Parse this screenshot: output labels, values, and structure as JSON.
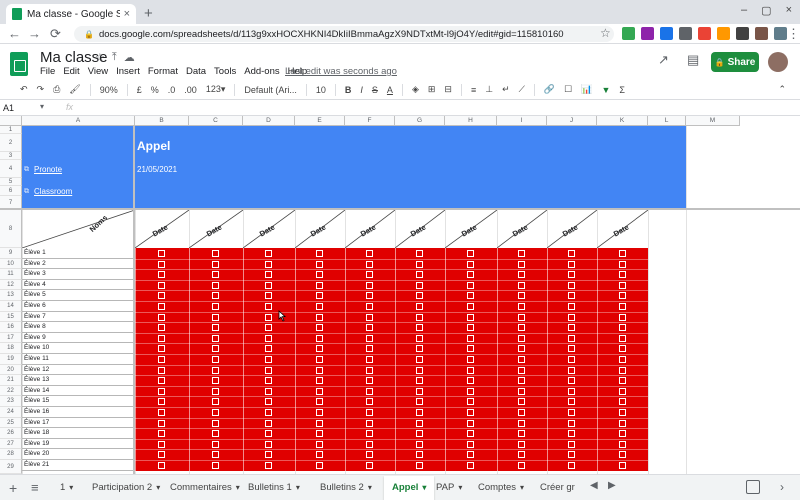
{
  "browser": {
    "tab_title": "Ma classe - Google Sheets",
    "tab_close": "×",
    "new_tab": "+",
    "window_controls": [
      "–",
      "▢",
      "×"
    ],
    "nav": {
      "back": "←",
      "forward": "→",
      "reload": "⟳"
    },
    "lock": "🔒",
    "url": "docs.google.com/spreadsheets/d/113g9xxHOCXHKNI4DkIiIBmmaAgzX9NDTxtMt-l9jO4Y/edit#gid=115810160",
    "star": "☆",
    "menu_dots": "⋮",
    "extension_colors": [
      "#34a853",
      "#8e24aa",
      "#1a73e8",
      "#5f6368",
      "#ea4335",
      "#ff9800",
      "#424242",
      "#795548",
      "#607d8b"
    ]
  },
  "sheets": {
    "doc_title": "Ma classe",
    "title_icons": [
      "☆",
      "⤒",
      "☁"
    ],
    "menu": [
      "File",
      "Edit",
      "View",
      "Insert",
      "Format",
      "Data",
      "Tools",
      "Add-ons",
      "Help"
    ],
    "last_edit": "Last edit was seconds ago",
    "share_label": "Share",
    "share_icon": "🔒",
    "icons_right": [
      "↗",
      "▤"
    ]
  },
  "toolbar": {
    "undo": "↶",
    "redo": "↷",
    "print": "⎙",
    "paint": "🖌",
    "zoom": "90%",
    "currency": "£",
    "percent": "%",
    "dec_down": ".0",
    "dec_up": ".00",
    "format_more": "123▾",
    "font": "Default (Ari...",
    "font_size": "10",
    "bold": "B",
    "italic": "I",
    "strike": "S",
    "text_color": "A",
    "fill": "◈",
    "borders": "⊞",
    "merge": "⊟",
    "halign": "≡",
    "valign": "⊥",
    "wrap": "↵",
    "rotate": "⟋",
    "link": "🔗",
    "comment": "☐",
    "chart": "📊",
    "filter": "▼",
    "functions": "Σ",
    "more": "⌃"
  },
  "formula_bar": {
    "cell_ref": "A1",
    "fx": "fx"
  },
  "grid": {
    "col_headers": [
      "A",
      "B",
      "C",
      "D",
      "E",
      "F",
      "G",
      "H",
      "I",
      "J",
      "K",
      "L",
      "M"
    ],
    "row_numbers": [
      "1",
      "2",
      "3",
      "4",
      "5",
      "6",
      "7",
      "8",
      "9",
      "10",
      "11",
      "12",
      "13",
      "14",
      "15",
      "16",
      "17",
      "18",
      "19",
      "20",
      "21",
      "22",
      "23",
      "24",
      "25",
      "26",
      "27",
      "28",
      "29"
    ],
    "title": "Appel",
    "date": "21/05/2021",
    "link_pronote": "Pronote",
    "link_classroom": "Classroom",
    "link_icon": "⧉",
    "header_noms": "Noms",
    "date_headers": [
      "Date",
      "Date",
      "Date",
      "Date",
      "Date",
      "Date",
      "Date",
      "Date",
      "Date",
      "Date"
    ],
    "students": [
      "Élève 1",
      "Élève 2",
      "Élève 3",
      "Élève 4",
      "Élève 5",
      "Élève 6",
      "Élève 7",
      "Élève 8",
      "Élève 9",
      "Élève 10",
      "Élève 11",
      "Élève 12",
      "Élève 13",
      "Élève 14",
      "Élève 15",
      "Élève 16",
      "Élève 17",
      "Élève 18",
      "Élève 19",
      "Élève 20",
      "Élève 21"
    ],
    "checkbox_fill": "#e00000",
    "header_blue": "#4285f4"
  },
  "bottom": {
    "add_sheet": "+",
    "all_sheets": "≡",
    "tabs": [
      "1",
      "Participation 2",
      "Commentaires",
      "Bulletins 1",
      "Bulletins 2",
      "Appel",
      "PAP",
      "Comptes",
      "Créer gr"
    ],
    "active_tab": "Appel",
    "tab_arrow": "▾",
    "scroll_arrows": [
      "◀",
      "▶"
    ],
    "side_arrow": "›"
  }
}
